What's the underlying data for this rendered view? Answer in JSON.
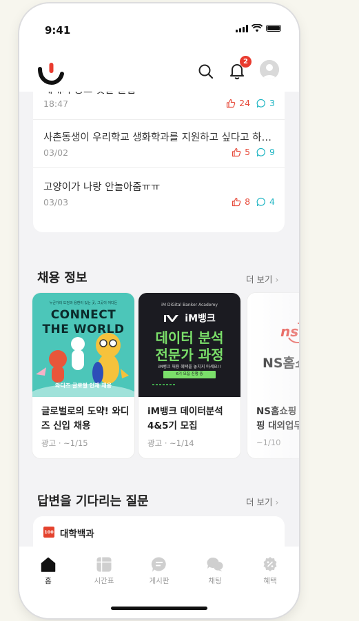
{
  "status_bar": {
    "time": "9:41"
  },
  "header": {
    "notification_count": "2",
    "accent": "#e93b2f"
  },
  "posts": [
    {
      "title": "새내기 종교 첫날 꿀팁",
      "date": "18:47",
      "likes": "24",
      "comments": "3"
    },
    {
      "title": "사촌동생이 우리학교 생화학과를 지원하고 싶다고 하…",
      "date": "03/02",
      "likes": "5",
      "comments": "9"
    },
    {
      "title": "고양이가 나랑 안놀아줌ㅠㅠ",
      "date": "03/03",
      "likes": "8",
      "comments": "4"
    }
  ],
  "jobs": {
    "title": "채용 정보",
    "more": "더 보기",
    "cards": [
      {
        "banner_top": "누군가의 도전과 용환이 있는 곳, 그곳이 어디든",
        "banner_headline1": "CONNECT",
        "banner_headline2": "THE WORLD",
        "banner_bottom": "와디즈 글로벌 인재 채용",
        "title": "글로벌로의 도약! 와디즈 신입 채용",
        "meta": "광고 · ~1/15"
      },
      {
        "banner_top": "iM DiGital Banker Academy",
        "banner_brand": "iM뱅크",
        "banner_headline1": "데이터 분석",
        "banner_headline2": "전문가 과정",
        "banner_sub": "iM뱅크 채용 혜택을 놓치지 마세요!!",
        "banner_pill": "6기 모집 진행 중",
        "title": "iM뱅크 데이터분석 4&5기 모집",
        "meta": "광고 · ~1/14"
      },
      {
        "banner_logo": "ns",
        "banner_brand": "NS홈쇼핑",
        "title": "NS홈쇼핑 : NS홈쇼핑 대외업무",
        "meta": "~1/10"
      }
    ]
  },
  "questions": {
    "title": "답변을 기다리는 질문",
    "more": "더 보기",
    "icon_text": "100",
    "category": "대학백과"
  },
  "tabbar": {
    "items": [
      {
        "label": "홈",
        "icon": "home-icon"
      },
      {
        "label": "시간표",
        "icon": "timetable-icon"
      },
      {
        "label": "게시판",
        "icon": "board-icon"
      },
      {
        "label": "채팅",
        "icon": "chat-icon"
      },
      {
        "label": "혜택",
        "icon": "benefit-icon"
      }
    ]
  }
}
